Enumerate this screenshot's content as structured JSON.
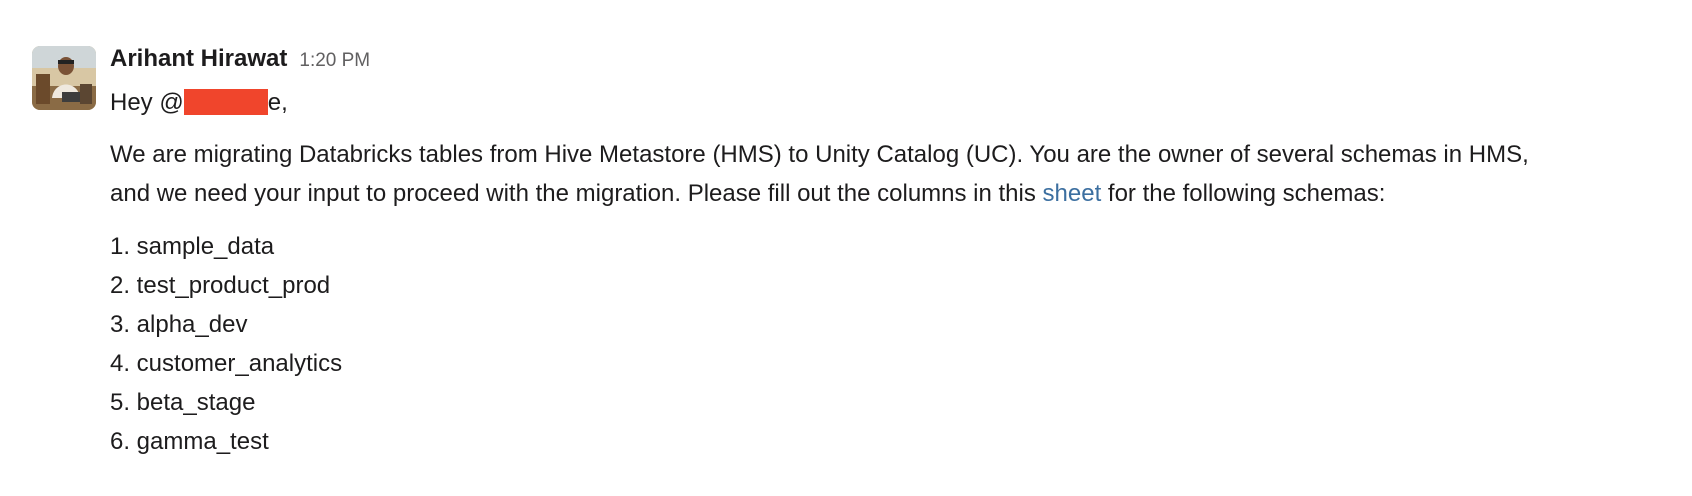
{
  "message": {
    "author": "Arihant Hirawat",
    "timestamp": "1:20 PM",
    "greeting_prefix": "Hey @",
    "greeting_suffix": "e,",
    "paragraph_line1": "We are migrating Databricks tables from Hive Metastore (HMS) to Unity Catalog (UC). You are the owner of several schemas in HMS,",
    "paragraph_line2_before_link": "and we need your input to proceed with the migration. Please fill out the columns in this ",
    "link_text": "sheet",
    "paragraph_line2_after_link": " for the following schemas:",
    "schemas": [
      "1. sample_data",
      "2. test_product_prod",
      "3. alpha_dev",
      "4. customer_analytics",
      "5. beta_stage",
      "6. gamma_test"
    ]
  },
  "colors": {
    "link": "#3c6fa0",
    "redaction": "#f0452c",
    "timestamp": "#616061",
    "text": "#1d1c1d"
  },
  "icons": {
    "avatar": "user-avatar-photo"
  }
}
